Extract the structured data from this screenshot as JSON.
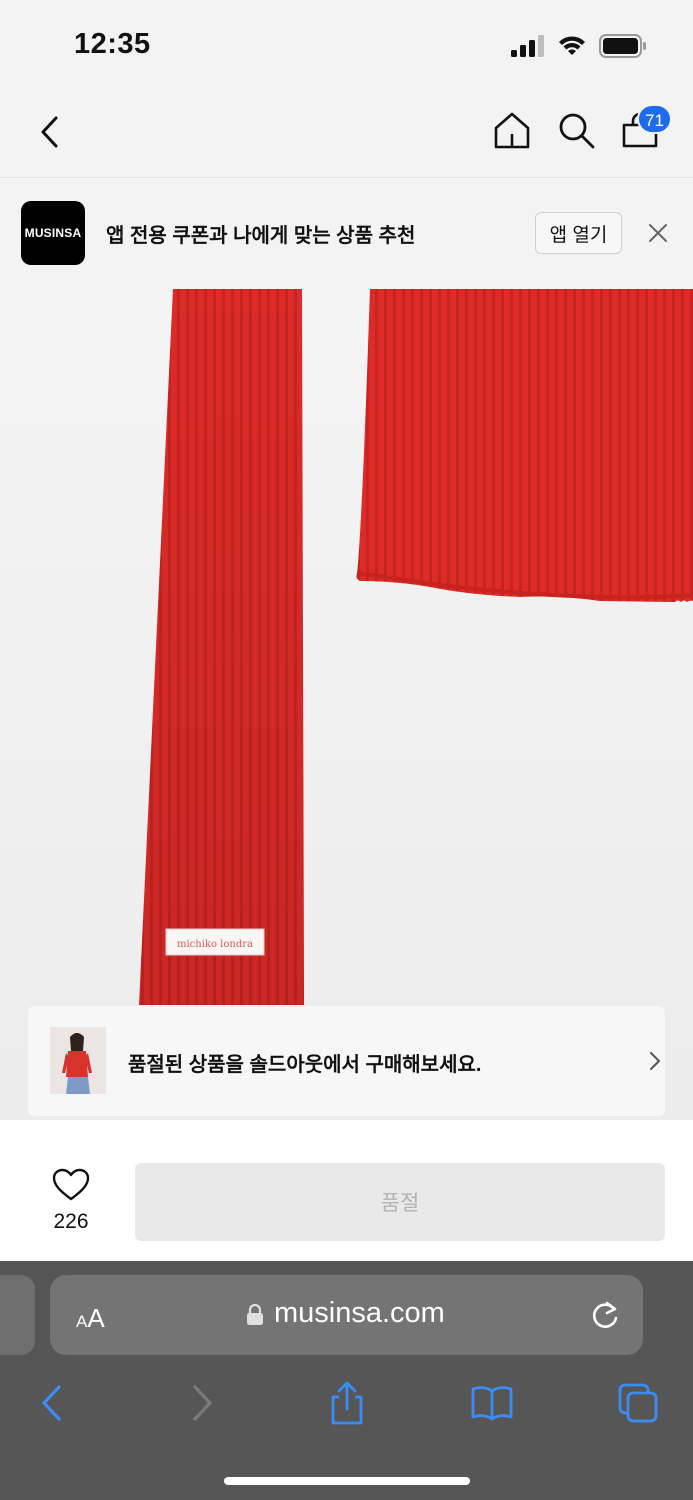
{
  "status_bar": {
    "time": "12:35"
  },
  "header": {
    "cart_count": "71"
  },
  "app_banner": {
    "logo_text": "MUSINSA",
    "message": "앱 전용 쿠폰과 나에게 맞는 상품 추천",
    "open_button": "앱 열기"
  },
  "product": {
    "label_text": "michiko londra",
    "colors": {
      "knit": "#dc2b28",
      "background": "#f2f2f2"
    }
  },
  "soldout_notice": {
    "text": "품절된 상품을 솔드아웃에서 구매해보세요."
  },
  "action_bar": {
    "like_count": "226",
    "buy_button": "품절"
  },
  "browser": {
    "text_size_label_small": "A",
    "text_size_label_large": "A",
    "url": "musinsa.com"
  },
  "icons": [
    "back-icon",
    "home-icon",
    "search-icon",
    "cart-icon",
    "close-icon",
    "chevron-right-icon",
    "heart-icon",
    "lock-icon",
    "reload-icon",
    "share-icon",
    "bookmarks-icon",
    "tabs-icon"
  ],
  "accent": "#1e6bf0"
}
